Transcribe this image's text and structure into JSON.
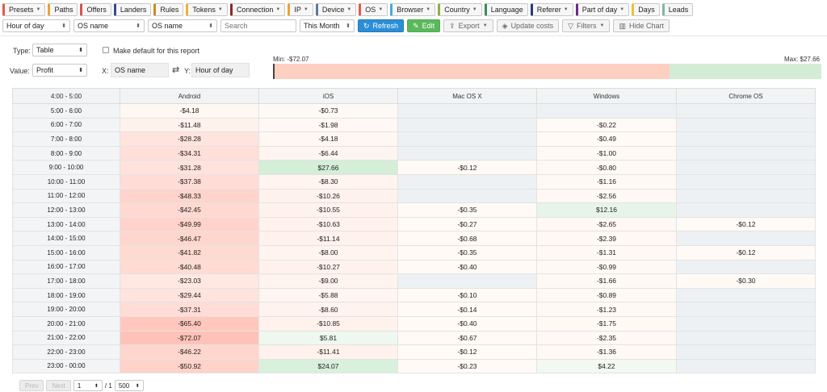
{
  "tabs": [
    {
      "label": "Presets",
      "color": "#e05a4a",
      "caret": true
    },
    {
      "label": "Paths",
      "color": "#e8a23c",
      "caret": false
    },
    {
      "label": "Offers",
      "color": "#d9534f",
      "caret": false
    },
    {
      "label": "Landers",
      "color": "#3b4a8c",
      "caret": false
    },
    {
      "label": "Rules",
      "color": "#c98a2a",
      "caret": false
    },
    {
      "label": "Tokens",
      "color": "#e8b23c",
      "caret": true
    },
    {
      "label": "Connection",
      "color": "#8a2a2a",
      "caret": true
    },
    {
      "label": "IP",
      "color": "#e8a23c",
      "caret": true
    },
    {
      "label": "Device",
      "color": "#5a7a9a",
      "caret": true
    },
    {
      "label": "OS",
      "color": "#e05a4a",
      "caret": true
    },
    {
      "label": "Browser",
      "color": "#4aa8d8",
      "caret": true
    },
    {
      "label": "Country",
      "color": "#8ab04a",
      "caret": true
    },
    {
      "label": "Language",
      "color": "#3a8a5a",
      "caret": false
    },
    {
      "label": "Referer",
      "color": "#2a3a7a",
      "caret": true
    },
    {
      "label": "Part of day",
      "color": "#6a2a8a",
      "caret": true
    },
    {
      "label": "Days",
      "color": "#e8c23c",
      "caret": false
    },
    {
      "label": "Leads",
      "color": "#7ab8a8",
      "caret": false
    }
  ],
  "toolbar": {
    "group1": "Hour of day",
    "group2": "OS name",
    "group3": "OS name",
    "search_placeholder": "Search",
    "date_range": "This Month",
    "refresh": "Refresh",
    "edit": "Edit",
    "export": "Export",
    "update_costs": "Update costs",
    "filters": "Filters",
    "hide_chart": "Hide Chart"
  },
  "options": {
    "type_label": "Type:",
    "type_value": "Table",
    "default_label": "Make default for this report",
    "value_label": "Value:",
    "value_value": "Profit",
    "x_label": "X:",
    "x_value": "OS name",
    "y_label": "Y:",
    "y_value": "Hour of day"
  },
  "scale": {
    "min_label": "Min: -$72.07",
    "max_label": "Max: $27.66",
    "min": -72.07,
    "max": 27.66,
    "neg_color": "#fccfc0",
    "pos_color": "#d4ecd6"
  },
  "table": {
    "corner": "4:00 - 5:00",
    "columns": [
      "Android",
      "iOS",
      "Mac OS X",
      "Windows",
      "Chrome OS"
    ],
    "rows": [
      {
        "hour": "5:00 - 6:00",
        "values": [
          "-$4.18",
          "-$0.73",
          "",
          "",
          ""
        ]
      },
      {
        "hour": "6:00 - 7:00",
        "values": [
          "-$11.48",
          "-$1.98",
          "",
          "-$0.22",
          ""
        ]
      },
      {
        "hour": "7:00 - 8:00",
        "values": [
          "-$28.28",
          "-$4.18",
          "",
          "-$0.49",
          ""
        ]
      },
      {
        "hour": "8:00 - 9:00",
        "values": [
          "-$34.31",
          "-$6.44",
          "",
          "-$1.00",
          ""
        ]
      },
      {
        "hour": "9:00 - 10:00",
        "values": [
          "-$31.28",
          "$27.66",
          "-$0.12",
          "-$0.80",
          ""
        ]
      },
      {
        "hour": "10:00 - 11:00",
        "values": [
          "-$37.38",
          "-$8.30",
          "",
          "-$1.16",
          ""
        ]
      },
      {
        "hour": "11:00 - 12:00",
        "values": [
          "-$48.33",
          "-$10.26",
          "",
          "-$2.56",
          ""
        ]
      },
      {
        "hour": "12:00 - 13:00",
        "values": [
          "-$42.45",
          "-$10.55",
          "-$0.35",
          "$12.16",
          ""
        ]
      },
      {
        "hour": "13:00 - 14:00",
        "values": [
          "-$49.99",
          "-$10.63",
          "-$0.27",
          "-$2.65",
          "-$0.12"
        ]
      },
      {
        "hour": "14:00 - 15:00",
        "values": [
          "-$46.47",
          "-$11.14",
          "-$0.68",
          "-$2.39",
          ""
        ]
      },
      {
        "hour": "15:00 - 16:00",
        "values": [
          "-$41.82",
          "-$8.00",
          "-$0.35",
          "-$1.31",
          "-$0.12"
        ]
      },
      {
        "hour": "16:00 - 17:00",
        "values": [
          "-$40.48",
          "-$10.27",
          "-$0.40",
          "-$0.99",
          ""
        ]
      },
      {
        "hour": "17:00 - 18:00",
        "values": [
          "-$23.03",
          "-$9.00",
          "",
          "-$1.66",
          "-$0.30"
        ]
      },
      {
        "hour": "18:00 - 19:00",
        "values": [
          "-$29.44",
          "-$5.88",
          "-$0.10",
          "-$0.89",
          ""
        ]
      },
      {
        "hour": "19:00 - 20:00",
        "values": [
          "-$37.31",
          "-$8.60",
          "-$0.14",
          "-$1.23",
          ""
        ]
      },
      {
        "hour": "20:00 - 21:00",
        "values": [
          "-$65.40",
          "-$10.85",
          "-$0.40",
          "-$1.75",
          ""
        ]
      },
      {
        "hour": "21:00 - 22:00",
        "values": [
          "-$72.07",
          "$5.81",
          "-$0.67",
          "-$2.35",
          ""
        ]
      },
      {
        "hour": "22:00 - 23:00",
        "values": [
          "-$46.22",
          "-$11.41",
          "-$0.12",
          "-$1.36",
          ""
        ]
      },
      {
        "hour": "23:00 - 00:00",
        "values": [
          "-$50.92",
          "$24.07",
          "-$0.23",
          "$4.22",
          ""
        ]
      }
    ]
  },
  "pager": {
    "prev": "Prev",
    "next": "Next",
    "page": "1",
    "of": "/ 1",
    "per_page": "500"
  }
}
